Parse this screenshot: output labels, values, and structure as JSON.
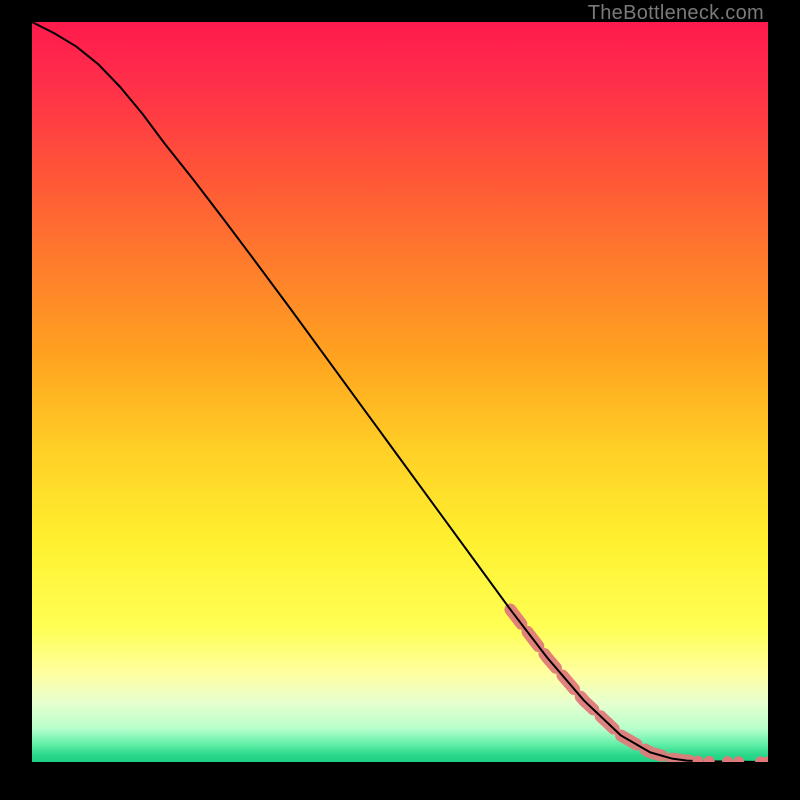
{
  "watermark": "TheBottleneck.com",
  "chart_data": {
    "type": "line",
    "title": "",
    "xlabel": "",
    "ylabel": "",
    "xlim": [
      0,
      100
    ],
    "ylim": [
      0,
      100
    ],
    "grid": false,
    "legend": false,
    "background_gradient_stops": [
      {
        "offset": 0.0,
        "color": "#ff1a4d"
      },
      {
        "offset": 0.08,
        "color": "#ff2e4a"
      },
      {
        "offset": 0.2,
        "color": "#ff5338"
      },
      {
        "offset": 0.32,
        "color": "#ff7a2d"
      },
      {
        "offset": 0.45,
        "color": "#ffa21f"
      },
      {
        "offset": 0.58,
        "color": "#ffd026"
      },
      {
        "offset": 0.7,
        "color": "#fff02f"
      },
      {
        "offset": 0.82,
        "color": "#ffff55"
      },
      {
        "offset": 0.88,
        "color": "#ffffa0"
      },
      {
        "offset": 0.92,
        "color": "#e7ffcf"
      },
      {
        "offset": 0.955,
        "color": "#b7ffcc"
      },
      {
        "offset": 0.975,
        "color": "#66f0aa"
      },
      {
        "offset": 0.99,
        "color": "#2cd98b"
      },
      {
        "offset": 1.0,
        "color": "#1ccf82"
      }
    ],
    "series": [
      {
        "name": "curve",
        "stroke": "#000000",
        "stroke_width": 2,
        "x": [
          0,
          3,
          6,
          9,
          12,
          15,
          18,
          22,
          26,
          30,
          35,
          40,
          45,
          50,
          55,
          60,
          65,
          70,
          75,
          80,
          84,
          87,
          89,
          90.5,
          92,
          94,
          96,
          98,
          100
        ],
        "y": [
          100,
          98.5,
          96.7,
          94.3,
          91.2,
          87.6,
          83.6,
          78.6,
          73.4,
          68.1,
          61.4,
          54.6,
          47.8,
          41.0,
          34.2,
          27.4,
          20.6,
          14.1,
          8.3,
          3.6,
          1.3,
          0.45,
          0.18,
          0.12,
          0.09,
          0.06,
          0.04,
          0.02,
          0.0
        ]
      }
    ],
    "highlight_band": {
      "name": "dotted-segment",
      "color": "#e07a7a",
      "stroke_width": 12,
      "dash": [
        18,
        10
      ],
      "x": [
        65,
        70,
        75,
        80,
        84,
        87,
        89,
        90.5
      ],
      "y": [
        20.6,
        14.1,
        8.3,
        3.6,
        1.3,
        0.45,
        0.18,
        0.12
      ]
    },
    "tail_dots": {
      "name": "tail-dots",
      "color": "#e07a7a",
      "radius": 5.5,
      "points": [
        {
          "x": 90.5,
          "y": 0.12
        },
        {
          "x": 92.0,
          "y": 0.09
        },
        {
          "x": 94.5,
          "y": 0.05
        },
        {
          "x": 96.0,
          "y": 0.04
        },
        {
          "x": 99.0,
          "y": 0.01
        },
        {
          "x": 100.0,
          "y": 0.0
        }
      ]
    }
  }
}
